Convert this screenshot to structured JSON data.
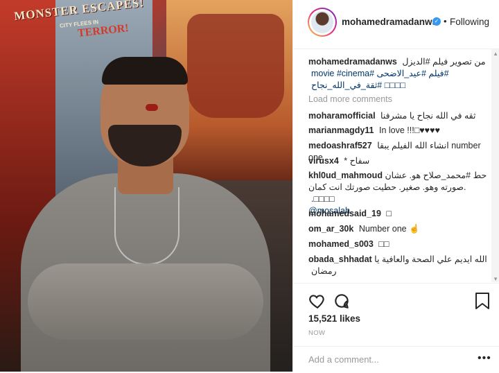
{
  "photo": {
    "headline": "MONSTER ESCAPES!",
    "headline_sub": "CITY FLEES IN",
    "headline_terror": "TERROR!"
  },
  "header": {
    "username": "mohamedramadanws",
    "verified_icon": "verified-badge-icon",
    "separator": "•",
    "follow_status": "Following"
  },
  "caption": {
    "username": "mohamedramadanws",
    "line1": "من تصوير فيلم #الديزل",
    "line2": "#فيلم #عيد_الاضحى  #movie #cinema",
    "line3": "□□□□ #ثقة_في_الله_نجاح"
  },
  "load_more": "Load more comments",
  "comments": [
    {
      "user": "moharamofficial",
      "text": "ثقه في الله نجاح يا مشرفنا"
    },
    {
      "user": "marianmagdy11",
      "text": "In love !!!□♥♥♥♥"
    },
    {
      "user": "medoashraf527",
      "text": "انشاء الله الفيلم يبقا number one"
    },
    {
      "user": "virusx4",
      "text": "سفاح *"
    },
    {
      "user": "khl0ud_mahmoud",
      "text": "حط #محمد_صلاح هو. عشان .صورته وهو. صغير. حطيت صورتك انت كمان □□□□.",
      "mention": "@mosalah"
    },
    {
      "user": "mohamedsaid_19",
      "text": "□"
    },
    {
      "user": "om_ar_30k",
      "text": "Number one ☝"
    },
    {
      "user": "mohamed_s003",
      "text": "□□"
    },
    {
      "user": "obada_shhadat",
      "text": "الله ايديم علي الصحة والعافية يا رمضان"
    }
  ],
  "actions": {
    "like_icon": "heart-icon",
    "comment_icon": "comment-bubble-icon",
    "save_icon": "bookmark-icon",
    "likes": "15,521 likes",
    "time": "NOW",
    "add_comment_placeholder": "Add a comment...",
    "more_label": "•••"
  }
}
